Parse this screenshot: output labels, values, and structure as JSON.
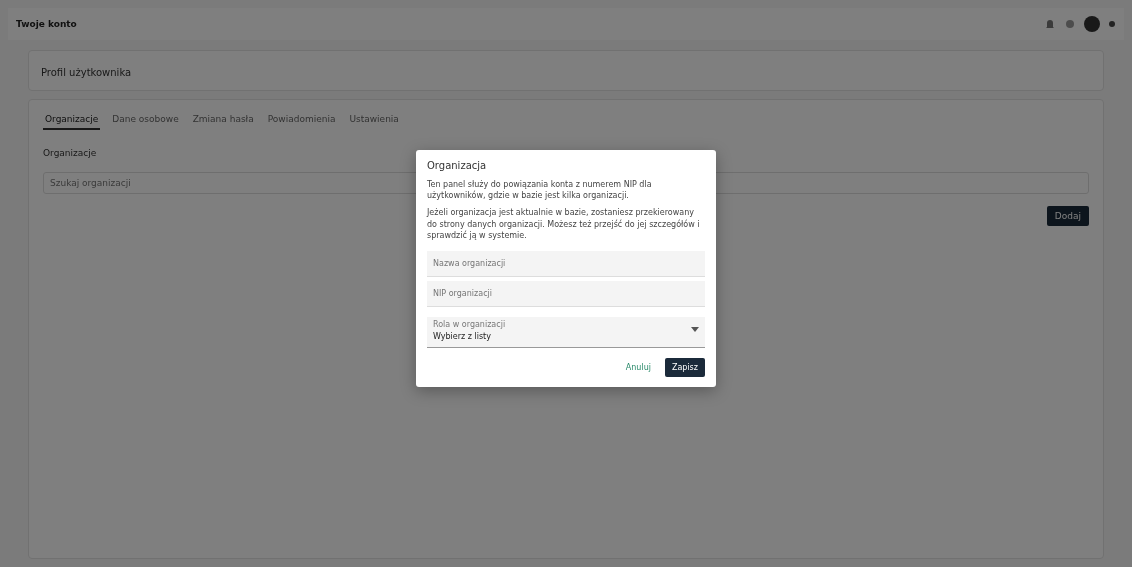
{
  "header": {
    "title": "Twoje konto"
  },
  "profile": {
    "title": "Profil użytkownika"
  },
  "tabs": [
    {
      "label": "Organizacje",
      "selected": true
    },
    {
      "label": "Dane osobowe",
      "selected": false
    },
    {
      "label": "Zmiana hasła",
      "selected": false
    },
    {
      "label": "Powiadomienia",
      "selected": false
    },
    {
      "label": "Ustawienia",
      "selected": false
    }
  ],
  "section": {
    "label": "Organizacje",
    "search_placeholder": "Szukaj organizacji",
    "add_button": "Dodaj"
  },
  "dialog": {
    "title": "Organizacja",
    "paragraphs": [
      "Ten panel służy do powiązania konta z numerem NIP dla użytkowników, gdzie w bazie jest kilka organizacji.",
      "Jeżeli organizacja jest aktualnie w bazie, zostaniesz przekierowany do strony danych organizacji. Możesz też przejść do jej szczegółów i sprawdzić ją w systemie."
    ],
    "fields": [
      {
        "kind": "input",
        "placeholder": "Nazwa organizacji"
      },
      {
        "kind": "input",
        "placeholder": "NIP organizacji"
      },
      {
        "kind": "select",
        "label": "Rola w organizacji",
        "value": "Wybierz z listy"
      }
    ],
    "cancel": "Anuluj",
    "save": "Zapisz"
  }
}
